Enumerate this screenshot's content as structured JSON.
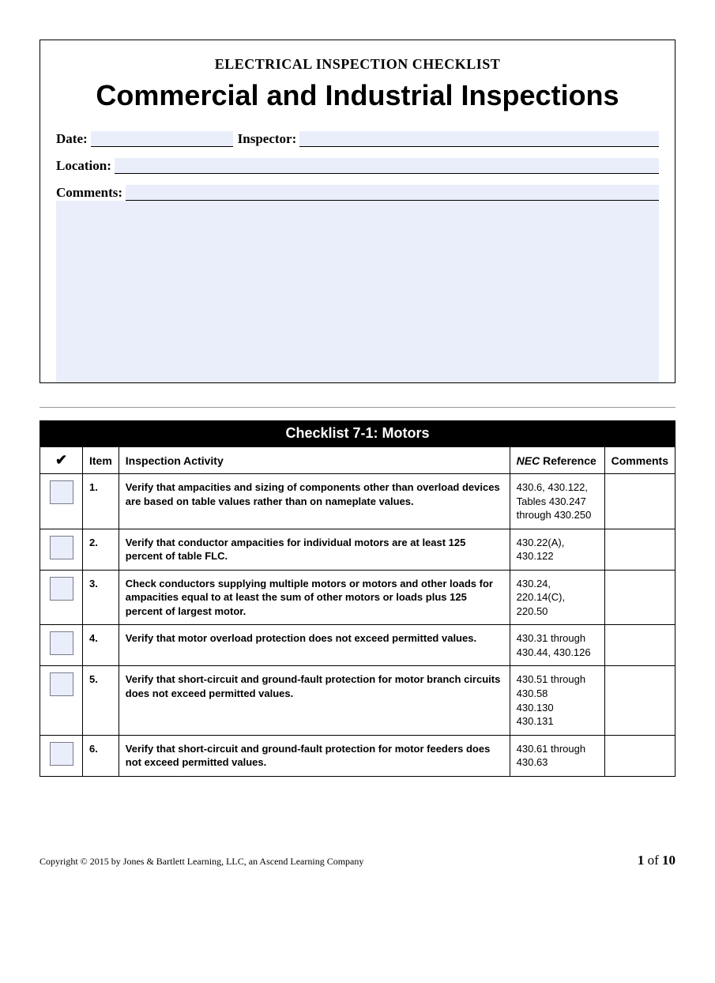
{
  "header": {
    "pre_title": "ELECTRICAL INSPECTION CHECKLIST",
    "main_title": "Commercial and Industrial Inspections",
    "fields": {
      "date_label": "Date:",
      "date_value": "",
      "inspector_label": "Inspector:",
      "inspector_value": "",
      "location_label": "Location:",
      "location_value": "",
      "comments_label": "Comments:",
      "comments_value": ""
    }
  },
  "checklist": {
    "title": "Checklist 7-1: Motors",
    "columns": {
      "check": "✔",
      "item": "Item",
      "activity": "Inspection Activity",
      "nec_prefix": "NEC",
      "nec_suffix": " Reference",
      "comments": "Comments"
    },
    "rows": [
      {
        "item": "1.",
        "activity": "Verify that ampacities and sizing of components other than overload devices are based on table values rather than on nameplate values.",
        "reference": "430.6, 430.122, Tables 430.247 through 430.250",
        "comments": ""
      },
      {
        "item": "2.",
        "activity": "Verify that conductor ampacities for individual motors are at least 125 percent of table FLC.",
        "reference": "430.22(A), 430.122",
        "comments": ""
      },
      {
        "item": "3.",
        "activity": "Check conductors supplying multiple motors or motors and other loads for ampacities equal to at least the sum of other motors or loads plus 125 percent of largest motor.",
        "reference": "430.24, 220.14(C), 220.50",
        "comments": ""
      },
      {
        "item": "4.",
        "activity": "Verify that motor overload protection does not exceed permitted values.",
        "reference": "430.31 through 430.44, 430.126",
        "comments": ""
      },
      {
        "item": "5.",
        "activity": "Verify that short-circuit and ground-fault protection for motor branch circuits does not exceed permitted values.",
        "reference": "430.51 through 430.58\n430.130\n430.131",
        "comments": ""
      },
      {
        "item": "6.",
        "activity": "Verify that short-circuit and ground-fault protection for motor feeders does not exceed permitted values.",
        "reference": "430.61 through 430.63",
        "comments": ""
      }
    ]
  },
  "footer": {
    "copyright": "Copyright © 2015 by Jones & Bartlett Learning, LLC, an Ascend Learning Company",
    "page_current": "1",
    "page_sep": " of ",
    "page_total": "10"
  }
}
